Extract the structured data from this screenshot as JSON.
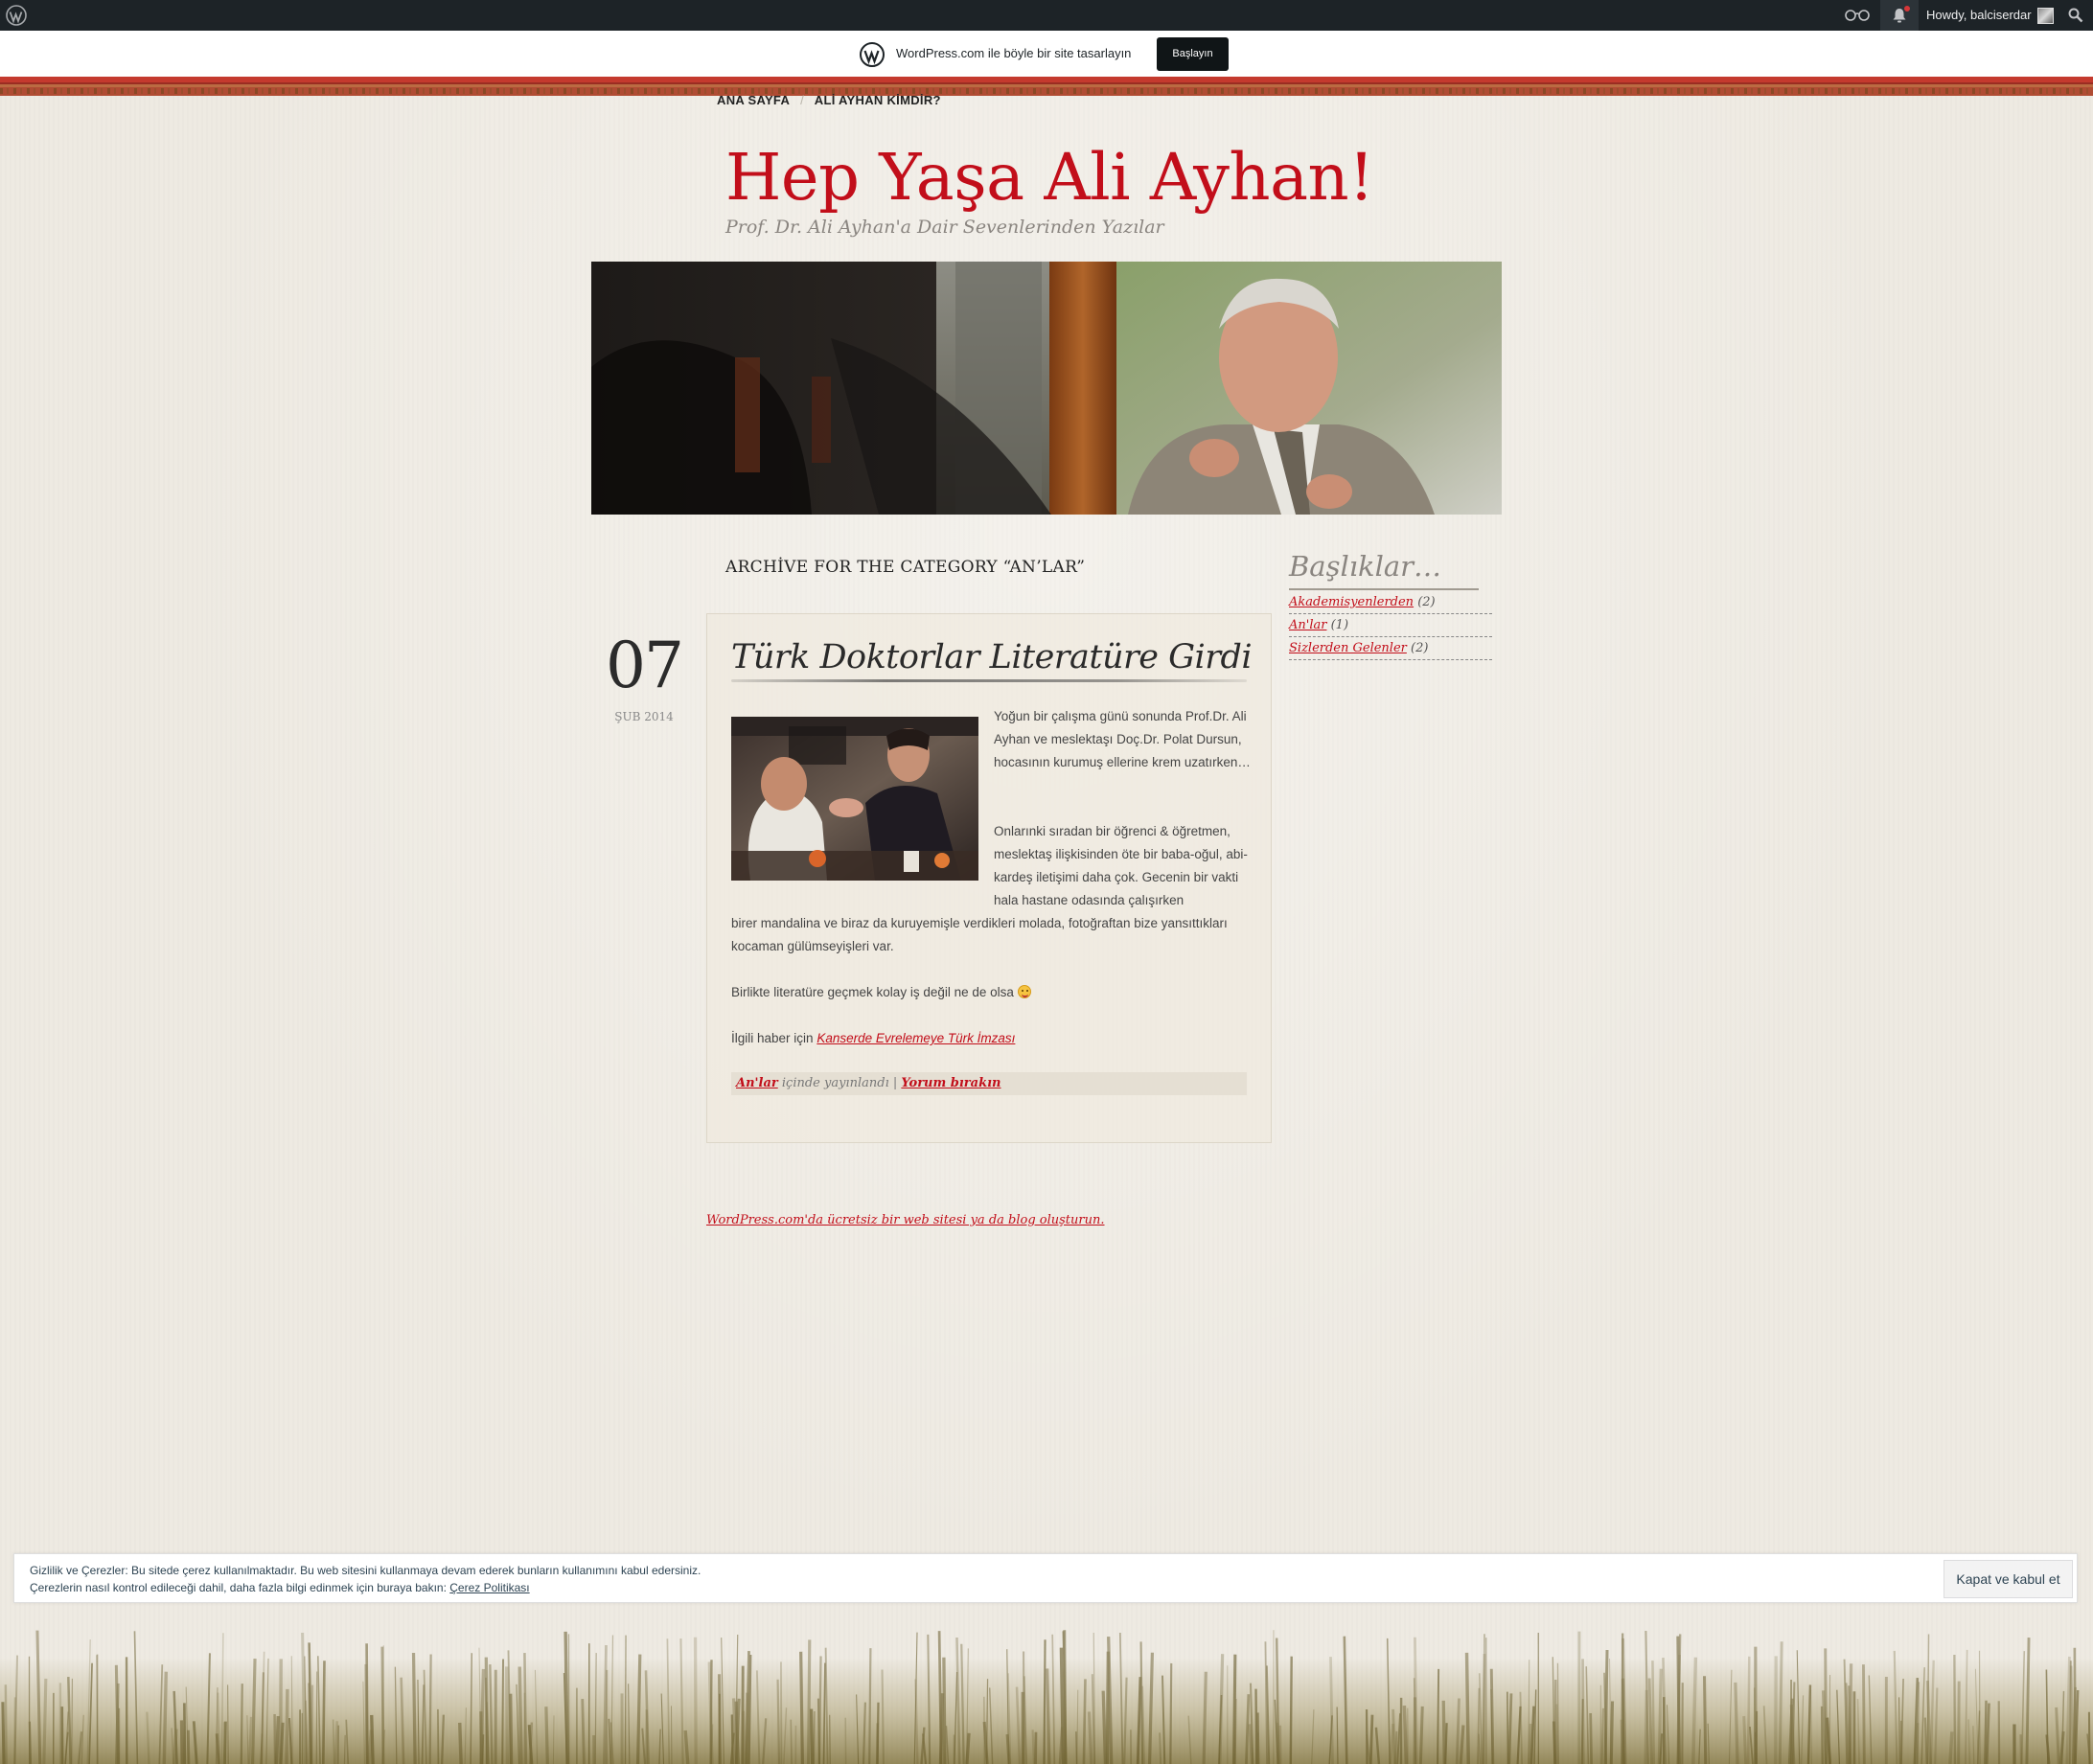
{
  "admin_bar": {
    "howdy": "Howdy, balciserdar",
    "icons": [
      "wordpress-logo-icon",
      "reader-icon",
      "notifications-icon",
      "avatar",
      "search-icon"
    ]
  },
  "wp_banner": {
    "text": "WordPress.com ile böyle bir site tasarlayın",
    "button": "Başlayın"
  },
  "nav": {
    "items": [
      "ANA SAYFA",
      "ALİ AYHAN KİMDİR?"
    ]
  },
  "site": {
    "title": "Hep Yaşa Ali Ayhan!",
    "description": "Prof. Dr. Ali Ayhan'a Dair Sevenlerinden Yazılar"
  },
  "archive_title": "ARCHİVE FOR THE CATEGORY “AN’LAR”",
  "post": {
    "day": "07",
    "month_year": "ŞUB 2014",
    "title": "Türk Doktorlar Literatüre Girdi",
    "p1": "Yoğun bir çalışma günü sonunda Prof.Dr. Ali Ayhan ve meslektaşı Doç.Dr. Polat Dursun, hocasının kurumuş ellerine krem uzatırken…",
    "p2a": "Onlarınki sıradan bir öğrenci & öğretmen, meslektaş ilişkisinden öte bir baba-oğul, abi-kardeş iletişimi daha çok. Gecenin bir vakti hala hastane odasında çalışırken",
    "p2b": "birer mandalina ve biraz da kuruyemişle verdikleri molada, fotoğraftan bize yansıttıkları kocaman gülümseyişleri var.",
    "p3": "Birlikte literatüre geçmek kolay iş değil ne de olsa",
    "p4_prefix": "İlgili haber için",
    "p4_link": "Kanserde Evrelemeye Türk İmzası",
    "meta_category": "An'lar",
    "meta_text": "içinde yayınlandı |",
    "meta_comment": "Yorum bırakın"
  },
  "sidebar": {
    "title": "Başlıklar…",
    "categories": [
      {
        "name": "Akademisyenlerden",
        "count": "(2)"
      },
      {
        "name": "An'lar",
        "count": "(1)"
      },
      {
        "name": "Sizlerden Gelenler",
        "count": "(2)"
      }
    ]
  },
  "footer": {
    "link": "WordPress.com'da ücretsiz bir web sitesi ya da blog oluşturun."
  },
  "cookie": {
    "line1": "Gizlilik ve Çerezler: Bu sitede çerez kullanılmaktadır. Bu web sitesini kullanmaya devam ederek bunların kullanımını kabul edersiniz.",
    "line2_prefix": "Çerezlerin nasıl kontrol edileceği dahil, daha fazla bilgi edinmek için buraya bakın:",
    "line2_link": "Çerez Politikası",
    "button": "Kapat ve kabul et"
  },
  "colors": {
    "accent_red": "#c20e1a",
    "admin_bar": "#1d2327",
    "paper": "#eeeae2"
  }
}
